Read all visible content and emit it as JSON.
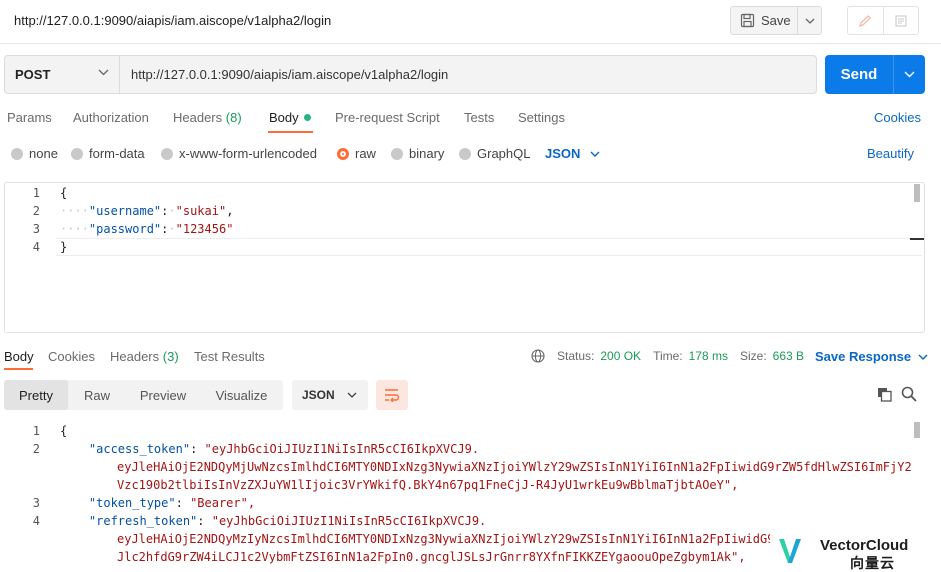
{
  "title_bar": {
    "url": "http://127.0.0.1:9090/aiapis/iam.aiscope/v1alpha2/login",
    "save_label": "Save"
  },
  "request": {
    "method": "POST",
    "url": "http://127.0.0.1:9090/aiapis/iam.aiscope/v1alpha2/login",
    "send_label": "Send",
    "tabs": {
      "params": "Params",
      "authorization": "Authorization",
      "headers": "Headers",
      "headers_count": "(8)",
      "body": "Body",
      "prerequest": "Pre-request Script",
      "tests": "Tests",
      "settings": "Settings"
    },
    "cookies_label": "Cookies",
    "body_types": {
      "none": "none",
      "form_data": "form-data",
      "urlencoded": "x-www-form-urlencoded",
      "raw": "raw",
      "binary": "binary",
      "graphql": "GraphQL"
    },
    "language": "JSON",
    "beautify_label": "Beautify",
    "editor": {
      "line_numbers": [
        "1",
        "2",
        "3",
        "4"
      ],
      "open_brace": "{",
      "close_brace": "}",
      "username_key": "\"username\"",
      "username_value": "\"sukai\"",
      "password_key": "\"password\"",
      "password_value": "\"123456\""
    }
  },
  "response": {
    "tabs": {
      "body": "Body",
      "cookies": "Cookies",
      "headers": "Headers",
      "headers_count": "(3)",
      "test_results": "Test Results"
    },
    "status_label": "Status:",
    "status_value": "200 OK",
    "time_label": "Time:",
    "time_value": "178 ms",
    "size_label": "Size:",
    "size_value": "663 B",
    "save_response_label": "Save Response",
    "views": {
      "pretty": "Pretty",
      "raw": "Raw",
      "preview": "Preview",
      "visualize": "Visualize"
    },
    "language": "JSON",
    "editor": {
      "line_numbers": [
        "1",
        "2",
        "3",
        "4"
      ],
      "open_brace": "{",
      "access_token_key": "\"access_token\"",
      "access_token_line1": "\"eyJhbGciOiJIUzI1NiIsInR5cCI6IkpXVCJ9.",
      "access_token_line2": "eyJleHAiOjE2NDQyMjUwNzcsImlhdCI6MTY0NDIxNzg3NywiaXNzIjoiYWlzY29wZSIsInN1YiI6InN1a2FpIiwidG9rZW5fdHlwZSI6ImFjY2",
      "access_token_line3": "Vzc190b2tlbiIsInVzZXJuYW1lIjoic3VrYWkifQ.BkY4n67pq1FneCjJ-R4JyU1wrkEu9wBblmaTjbtAOeY\",",
      "token_type_key": "\"token_type\"",
      "token_type_value": "\"Bearer\",",
      "refresh_token_key": "\"refresh_token\"",
      "refresh_token_line1": "\"eyJhbGciOiJIUzI1NiIsInR5cCI6IkpXVCJ9.",
      "refresh_token_line2": "eyJleHAiOjE2NDQyMzIyNzcsImlhdCI6MTY0NDIxNzg3NywiaXNzIjoiYWlzY29wZSIsInN1YiI6InN1a2FpIiwidG9",
      "refresh_token_line3": "Jlc2hfdG9rZW4iLCJ1c2VybmFtZSI6InN1a2FpIn0.gncglJSLsJrGnrr8YXfnFIKKZEYgaoouOpeZgbym1Ak\","
    }
  },
  "watermark": {
    "name": "VectorCloud",
    "subtitle": "向量云"
  },
  "colors": {
    "accent_orange": "#ff6c37",
    "link_blue": "#0b67c5",
    "send_blue": "#0c7bea",
    "status_green": "#1b9a59"
  }
}
